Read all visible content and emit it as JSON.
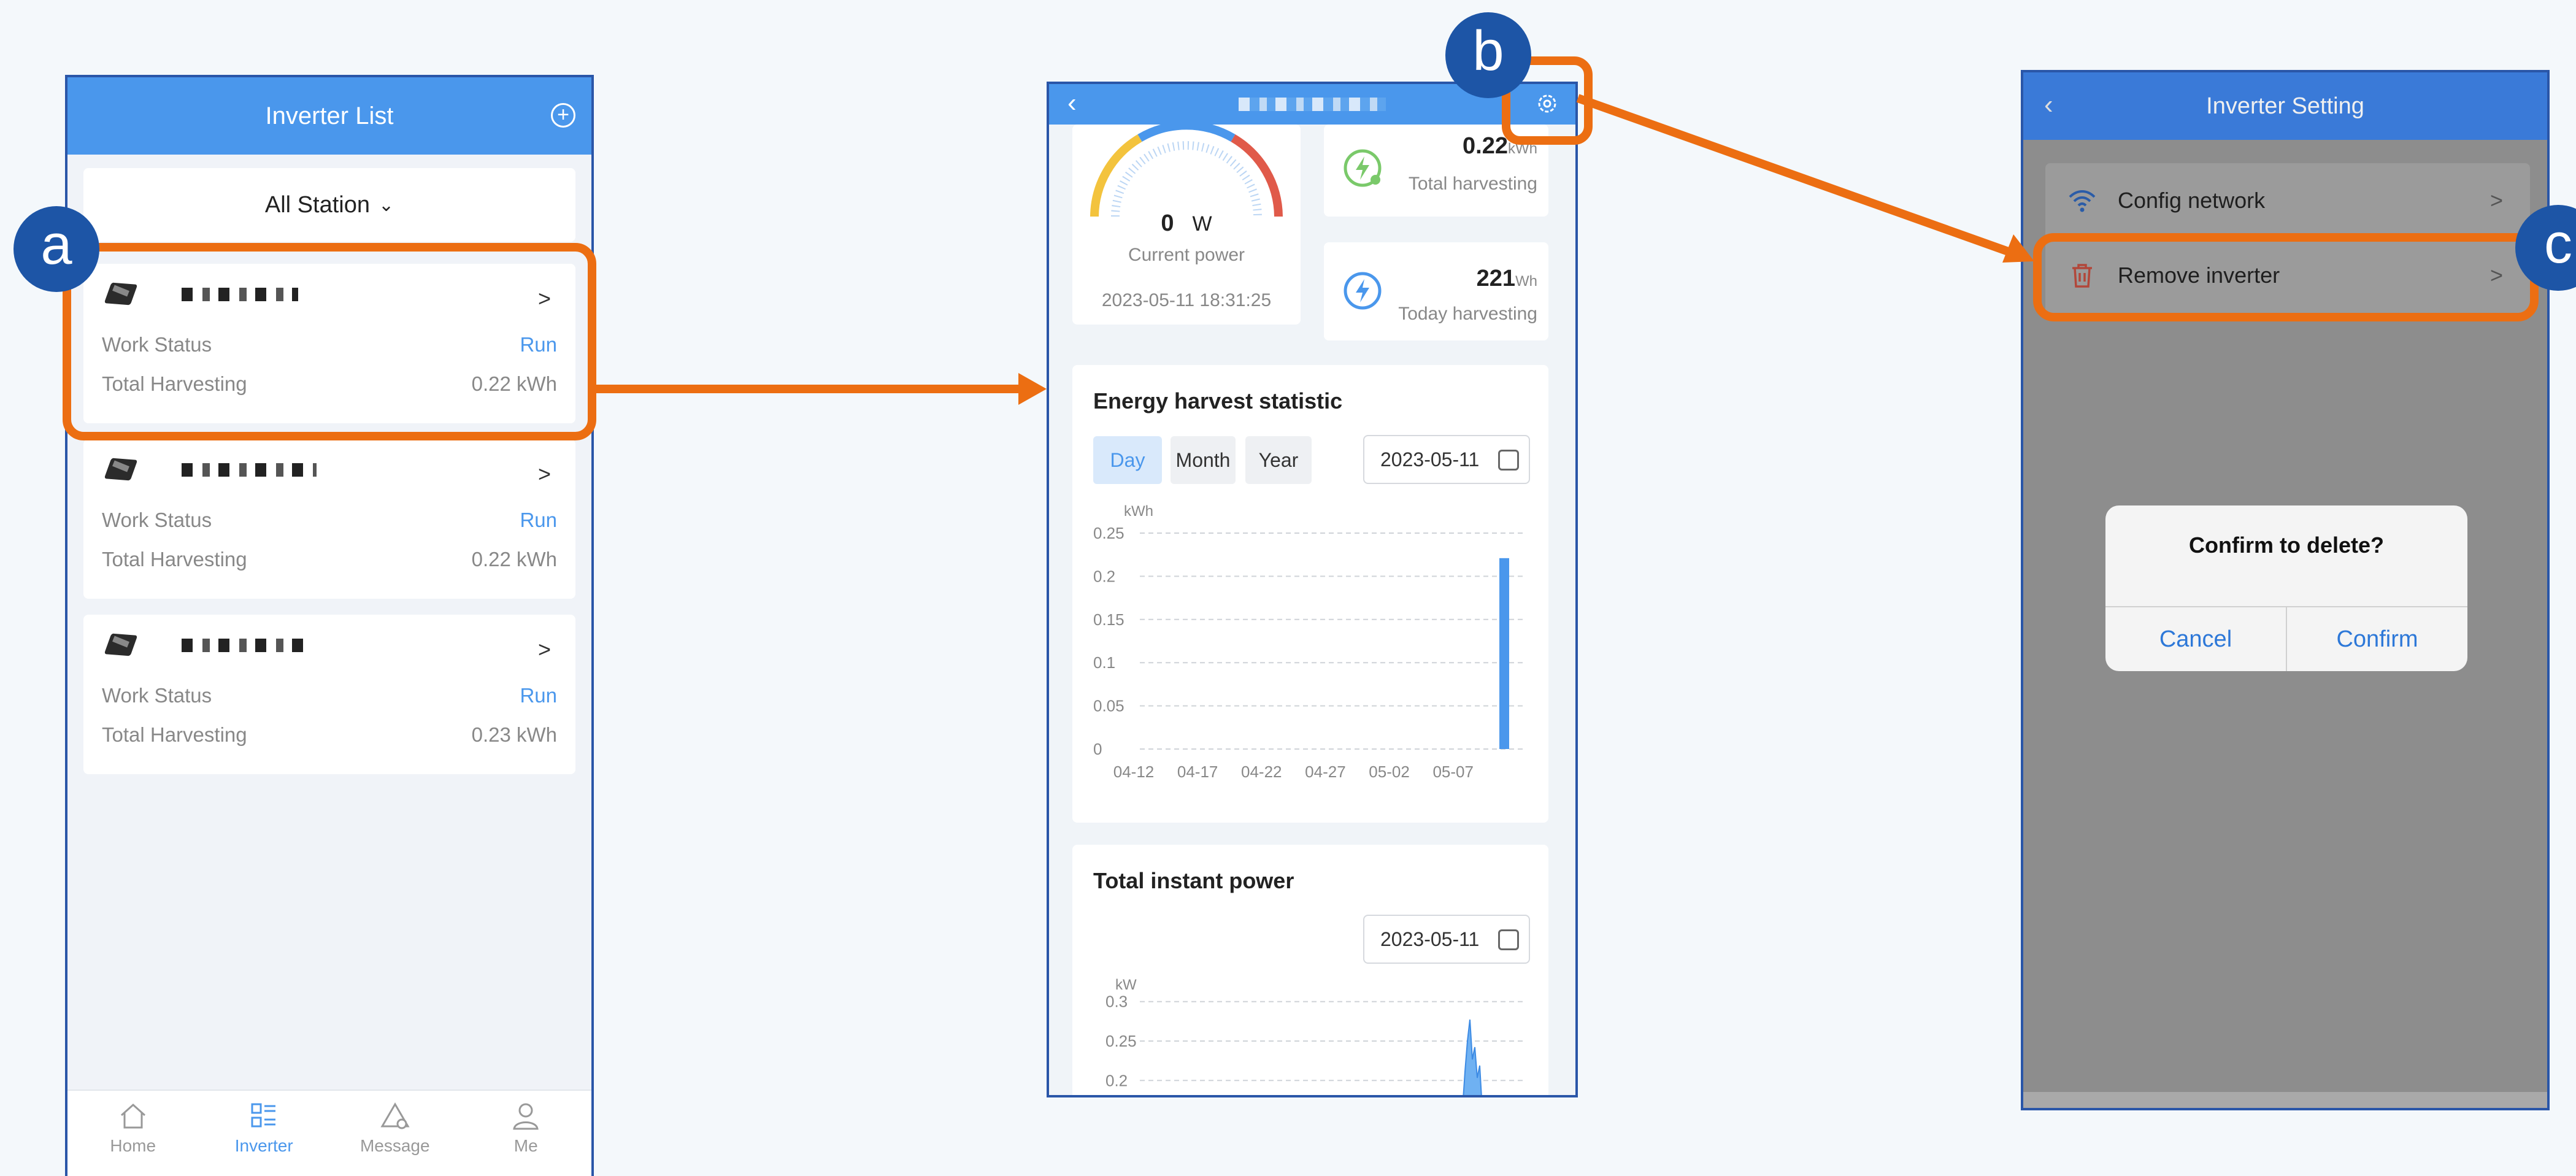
{
  "annotations": {
    "a": "a",
    "b": "b",
    "c": "c"
  },
  "colors": {
    "primary": "#4a97ec",
    "annotation_orange": "#ec6e12",
    "badge_blue": "#1d55a6"
  },
  "inverter_list": {
    "title": "Inverter List",
    "add_icon": "plus-circle-icon",
    "station_filter": "All Station",
    "items": [
      {
        "work_status_label": "Work Status",
        "work_status": "Run",
        "total_label": "Total Harvesting",
        "total": "0.22 kWh"
      },
      {
        "work_status_label": "Work Status",
        "work_status": "Run",
        "total_label": "Total Harvesting",
        "total": "0.22 kWh"
      },
      {
        "work_status_label": "Work Status",
        "work_status": "Run",
        "total_label": "Total Harvesting",
        "total": "0.23 kWh"
      }
    ],
    "tabs": [
      {
        "label": "Home",
        "icon": "home-icon"
      },
      {
        "label": "Inverter",
        "icon": "list-icon"
      },
      {
        "label": "Message",
        "icon": "alert-icon"
      },
      {
        "label": "Me",
        "icon": "user-icon"
      }
    ]
  },
  "detail": {
    "current_power_value": "0",
    "current_power_unit": "W",
    "current_power_label": "Current power",
    "timestamp": "2023-05-11 18:31:25",
    "total_harvesting_value": "0.22",
    "total_harvesting_unit": "kWh",
    "total_harvesting_label": "Total harvesting",
    "today_harvesting_value": "221",
    "today_harvesting_unit": "Wh",
    "today_harvesting_label": "Today harvesting",
    "energy_title": "Energy harvest statistic",
    "segments": [
      "Day",
      "Month",
      "Year"
    ],
    "energy_date": "2023-05-11",
    "power_title": "Total instant power",
    "power_date": "2023-05-11"
  },
  "chart_data": [
    {
      "type": "bar",
      "ylabel": "kWh",
      "ylim": [
        0,
        0.25
      ],
      "yticks": [
        "0",
        "0.05",
        "0.1",
        "0.15",
        "0.2",
        "0.25"
      ],
      "xticks": [
        "04-12",
        "04-17",
        "04-22",
        "04-27",
        "05-02",
        "05-07"
      ],
      "x": [
        "04-12",
        "04-13",
        "04-14",
        "04-15",
        "04-16",
        "04-17",
        "04-18",
        "04-19",
        "04-20",
        "04-21",
        "04-22",
        "04-23",
        "04-24",
        "04-25",
        "04-26",
        "04-27",
        "04-28",
        "04-29",
        "04-30",
        "05-01",
        "05-02",
        "05-03",
        "05-04",
        "05-05",
        "05-06",
        "05-07",
        "05-08",
        "05-09",
        "05-10",
        "05-11"
      ],
      "values": [
        0,
        0,
        0,
        0,
        0,
        0,
        0,
        0,
        0,
        0,
        0,
        0,
        0,
        0,
        0,
        0,
        0,
        0,
        0,
        0,
        0,
        0,
        0,
        0,
        0,
        0,
        0,
        0,
        0,
        0.221
      ],
      "grid": true
    },
    {
      "type": "area",
      "ylabel": "kW",
      "yticks": [
        "0.3",
        "0.25",
        "0.2"
      ],
      "ylim": [
        0.18,
        0.32
      ],
      "grid": true
    }
  ],
  "settings": {
    "title": "Inverter Setting",
    "config_label": "Config network",
    "remove_label": "Remove inverter",
    "dialog_question": "Confirm to delete?",
    "cancel_label": "Cancel",
    "confirm_label": "Confirm"
  }
}
